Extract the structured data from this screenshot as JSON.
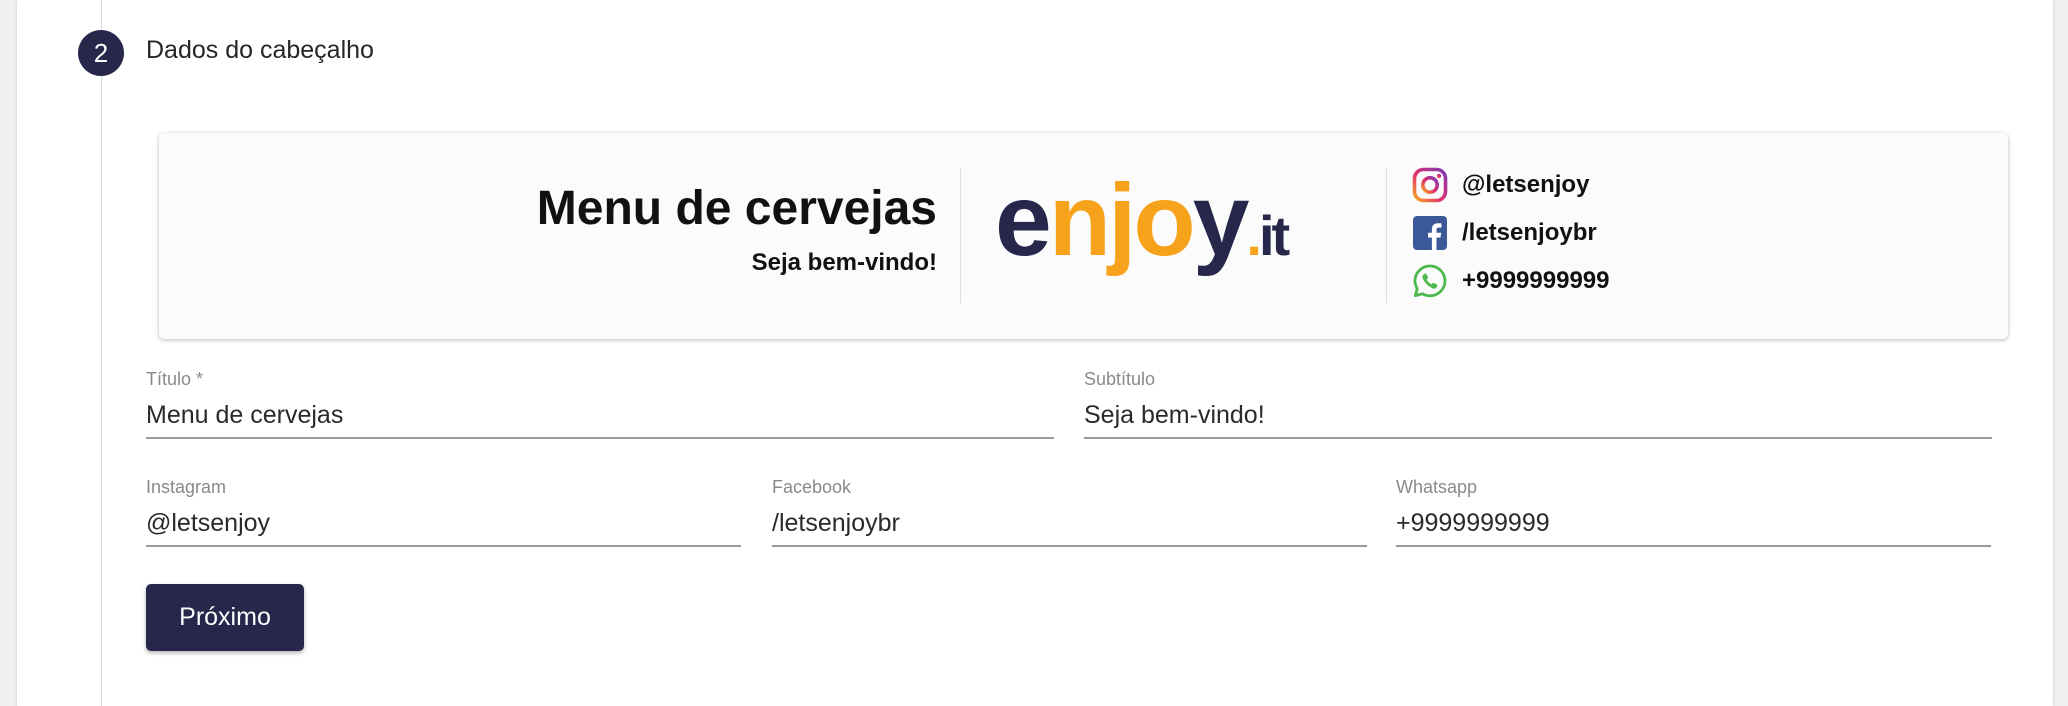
{
  "step": {
    "number": "2",
    "title": "Dados do cabeçalho"
  },
  "preview": {
    "title": "Menu de cervejas",
    "subtitle": "Seja bem-vindo!",
    "logo": {
      "part1": "e",
      "part2": "njo",
      "part3": "y",
      "dot": ".",
      "suffix": "it",
      "dark_color": "#26274a",
      "accent_color": "#f6a21a"
    },
    "social": {
      "instagram": "@letsenjoy",
      "facebook": "/letsenjoybr",
      "whatsapp": "+9999999999"
    }
  },
  "form": {
    "titulo": {
      "label": "Título *",
      "value": "Menu de cervejas"
    },
    "subtitulo": {
      "label": "Subtítulo",
      "value": "Seja bem-vindo!"
    },
    "instagram": {
      "label": "Instagram",
      "value": "@letsenjoy"
    },
    "facebook": {
      "label": "Facebook",
      "value": "/letsenjoybr"
    },
    "whatsapp": {
      "label": "Whatsapp",
      "value": "+9999999999"
    }
  },
  "actions": {
    "next_label": "Próximo"
  },
  "colors": {
    "primary": "#26274a",
    "accent": "#f6a21a",
    "facebook": "#3b5998",
    "whatsapp": "#4cb94d"
  },
  "icons": {
    "instagram": "instagram-icon",
    "facebook": "facebook-icon",
    "whatsapp": "whatsapp-icon"
  }
}
